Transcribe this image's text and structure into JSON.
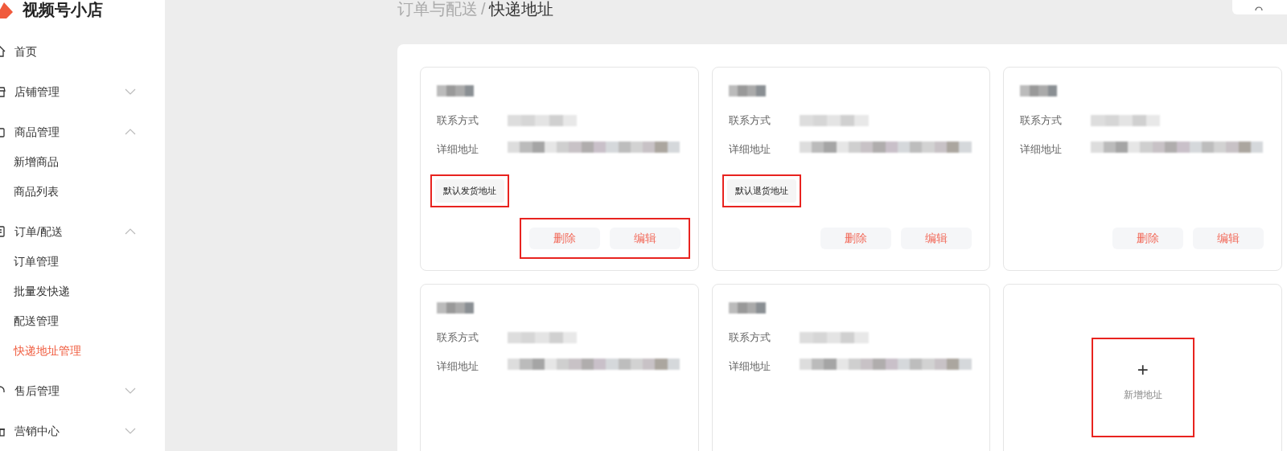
{
  "app": {
    "title": "视频号小店"
  },
  "sidebar": {
    "items": [
      {
        "label": "首页",
        "selected": false
      },
      {
        "label": "店铺管理",
        "expanded": false,
        "selected": false
      },
      {
        "label": "商品管理",
        "expanded": true,
        "selected": false,
        "children": [
          {
            "label": "新增商品",
            "selected": false
          },
          {
            "label": "商品列表",
            "selected": false
          }
        ]
      },
      {
        "label": "订单/配送",
        "expanded": true,
        "selected": false,
        "children": [
          {
            "label": "订单管理",
            "selected": false
          },
          {
            "label": "批量发快递",
            "selected": false
          },
          {
            "label": "配送管理",
            "selected": false
          },
          {
            "label": "快递地址管理",
            "selected": true
          }
        ]
      },
      {
        "label": "售后管理",
        "expanded": false,
        "selected": false
      },
      {
        "label": "营销中心",
        "expanded": false,
        "selected": false
      }
    ]
  },
  "breadcrumb": {
    "parent": "订单与配送",
    "separator": "/",
    "current": "快递地址"
  },
  "cards": [
    {
      "kind": "address",
      "contact_label": "联系方式",
      "address_label": "详细地址",
      "tag": "默认发货地址",
      "tag_highlighted": true,
      "buttons": [
        "删除",
        "编辑"
      ],
      "buttons_highlighted": true
    },
    {
      "kind": "address",
      "contact_label": "联系方式",
      "address_label": "详细地址",
      "tag": "默认退货地址",
      "tag_highlighted": true,
      "buttons": [
        "删除",
        "编辑"
      ],
      "buttons_highlighted": false
    },
    {
      "kind": "address",
      "contact_label": "联系方式",
      "address_label": "详细地址",
      "buttons": [
        "删除",
        "编辑"
      ],
      "buttons_highlighted": false
    },
    {
      "kind": "address",
      "contact_label": "联系方式",
      "address_label": "详细地址"
    },
    {
      "kind": "address",
      "contact_label": "联系方式",
      "address_label": "详细地址"
    },
    {
      "kind": "add",
      "symbol": "+",
      "label": "新增地址",
      "highlighted": true
    }
  ]
}
